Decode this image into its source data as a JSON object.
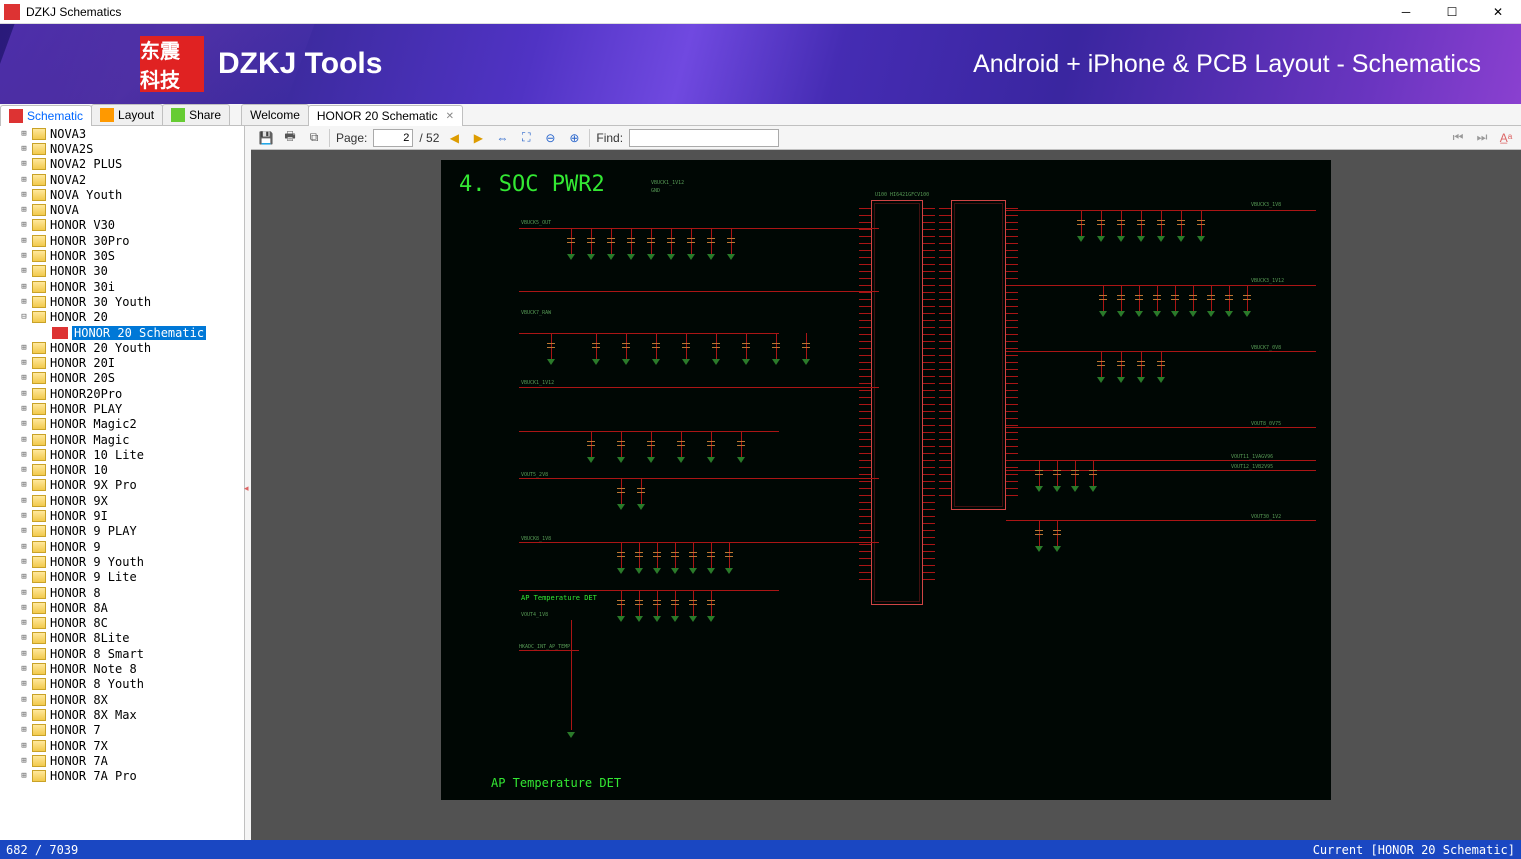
{
  "window": {
    "title": "DZKJ Schematics"
  },
  "banner": {
    "logo_text": "东震\n科技",
    "title": "DZKJ Tools",
    "right": "Android + iPhone & PCB Layout - Schematics"
  },
  "tabs": {
    "main": [
      {
        "label": "Schematic",
        "icon": "pdf"
      },
      {
        "label": "Layout",
        "icon": "pads"
      },
      {
        "label": "Share",
        "icon": "share"
      }
    ],
    "docs": [
      {
        "label": "Welcome"
      },
      {
        "label": "HONOR 20 Schematic",
        "closable": true,
        "active": true
      }
    ]
  },
  "toolbar": {
    "page_label": "Page:",
    "page": "2",
    "page_total": "/ 52",
    "find_label": "Find:"
  },
  "tree": [
    {
      "label": "NOVA3"
    },
    {
      "label": "NOVA2S"
    },
    {
      "label": "NOVA2 PLUS"
    },
    {
      "label": "NOVA2"
    },
    {
      "label": "NOVA Youth"
    },
    {
      "label": "NOVA"
    },
    {
      "label": "HONOR V30"
    },
    {
      "label": "HONOR 30Pro"
    },
    {
      "label": "HONOR 30S"
    },
    {
      "label": "HONOR 30"
    },
    {
      "label": "HONOR 30i"
    },
    {
      "label": "HONOR 30 Youth"
    },
    {
      "label": "HONOR 20",
      "expanded": true,
      "children": [
        {
          "label": "HONOR 20 Schematic",
          "selected": true
        }
      ]
    },
    {
      "label": "HONOR 20 Youth"
    },
    {
      "label": "HONOR 20I"
    },
    {
      "label": "HONOR 20S"
    },
    {
      "label": "HONOR20Pro"
    },
    {
      "label": "HONOR PLAY"
    },
    {
      "label": "HONOR Magic2"
    },
    {
      "label": "HONOR Magic"
    },
    {
      "label": "HONOR 10 Lite"
    },
    {
      "label": "HONOR 10"
    },
    {
      "label": "HONOR 9X Pro"
    },
    {
      "label": "HONOR 9X"
    },
    {
      "label": "HONOR 9I"
    },
    {
      "label": "HONOR 9 PLAY"
    },
    {
      "label": "HONOR 9"
    },
    {
      "label": "HONOR 9 Youth"
    },
    {
      "label": "HONOR 9 Lite"
    },
    {
      "label": "HONOR 8"
    },
    {
      "label": "HONOR 8A"
    },
    {
      "label": "HONOR 8C"
    },
    {
      "label": "HONOR 8Lite"
    },
    {
      "label": "HONOR 8 Smart"
    },
    {
      "label": "HONOR Note 8"
    },
    {
      "label": "HONOR 8 Youth"
    },
    {
      "label": "HONOR 8X"
    },
    {
      "label": "HONOR 8X Max"
    },
    {
      "label": "HONOR 7"
    },
    {
      "label": "HONOR 7X"
    },
    {
      "label": "HONOR 7A"
    },
    {
      "label": "HONOR 7A Pro"
    }
  ],
  "schematic": {
    "title": "4. SOC PWR2",
    "sub": "AP Temperature DET",
    "sub2": "AP Temperature DET",
    "nets": [
      "VBUCK1_1V12",
      "GND",
      "VBUCK5_OUT",
      "VBUCK7_RAW",
      "VBUCK1_1V12",
      "VOUT5_2V8",
      "VBUCK8_1V8",
      "HKADC_INT_AP_TEMP",
      "VOUT4_1V8",
      "VBUCK3_1V8",
      "VBUCK3_1V12",
      "VBUCK7_0V8",
      "VOUT8_0V75",
      "VOUT11_1VAGV96",
      "VOUT12_1VB2V95",
      "VOUT30_1V2"
    ],
    "chips": [
      "U100 HI6421GFCV100"
    ]
  },
  "status": {
    "left": "682 / 7039",
    "right": "Current [HONOR 20 Schematic]"
  }
}
